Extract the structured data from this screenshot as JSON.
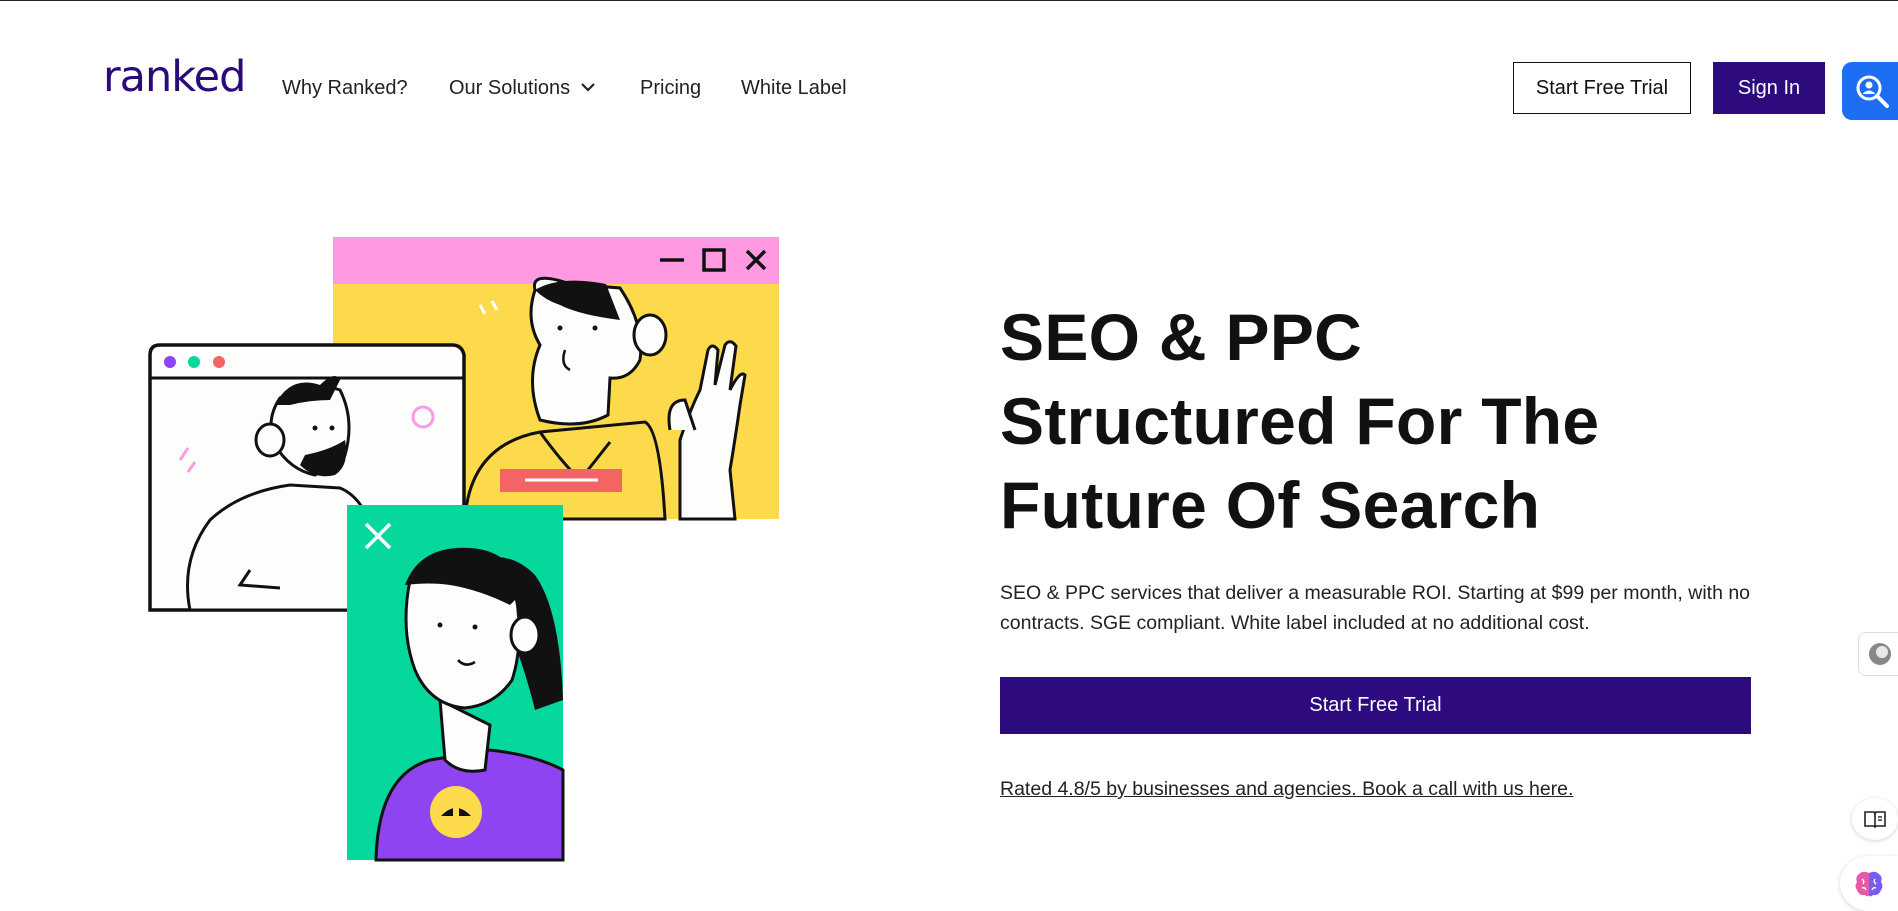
{
  "header": {
    "logo_text": "ranked",
    "nav": [
      {
        "label": "Why Ranked?"
      },
      {
        "label": "Our Solutions"
      },
      {
        "label": "Pricing"
      },
      {
        "label": "White Label"
      }
    ],
    "start_trial_label": "Start Free Trial",
    "sign_in_label": "Sign In"
  },
  "hero": {
    "title_lines": [
      "SEO & PPC",
      "Structured For The",
      "Future Of Search"
    ],
    "description": "SEO & PPC services that deliver a measurable ROI. Starting at $99 per month, with no contracts. SGE compliant. White label included at no additional cost.",
    "cta_label": "Start Free Trial",
    "rating_text": "Rated 4.8/5 by businesses and agencies. Book a call with us here."
  },
  "colors": {
    "brand_purple": "#2e0a7f",
    "extension_blue": "#1d6ef2",
    "illus_pink": "#ff9ae2",
    "illus_yellow": "#fdd94c",
    "illus_green": "#06d89d",
    "illus_purple": "#8f44f1",
    "illus_red": "#f46464"
  },
  "icons": {
    "search_extension": "search-person-icon",
    "side_widget_1": "circle-widget-icon",
    "side_widget_2": "book-reader-icon",
    "side_widget_3": "brain-icon"
  }
}
